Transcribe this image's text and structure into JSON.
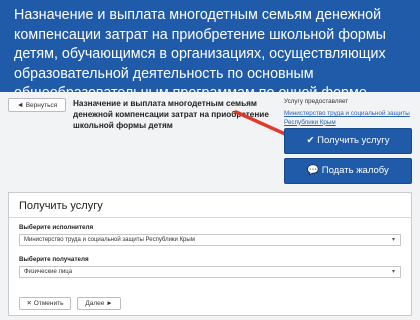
{
  "header": {
    "title": "Назначение и выплата многодетным семьям денежной компенсации затрат на приобретение школьной формы детям, обучающимся в организациях, осуществляющих образовательной деятельность по основным общеобразовательным программам по очной форме обучения, расположенных на территории Республики Крым"
  },
  "toolbar": {
    "back_icon": "chevron-left-icon",
    "back_label": "Вернуться"
  },
  "service": {
    "title": "Назначение и выплата многодетным семьям денежной компенсации затрат на приобретение школьной формы детям"
  },
  "provider": {
    "heading": "Услугу предоставляет",
    "link": "Министерство труда и социальной защиты Республики Крым"
  },
  "actions": {
    "get_service_icon": "check-icon",
    "get_service_label": "Получить услугу",
    "complaint_icon": "speech-bubble-icon",
    "complaint_label": "Подать жалобу"
  },
  "form": {
    "title": "Получить услугу",
    "executor_label": "Выберите исполнителя",
    "executor_value": "Министерство труда и социальной защиты Республики Крым",
    "recipient_label": "Выберите получателя",
    "recipient_value": "Физические лица",
    "cancel_icon": "close-icon",
    "cancel_label": "Отменить",
    "next_label": "Далее",
    "next_icon": "chevron-right-icon"
  },
  "colors": {
    "accent": "#1f5ba8",
    "arrow": "#e03a2e"
  }
}
